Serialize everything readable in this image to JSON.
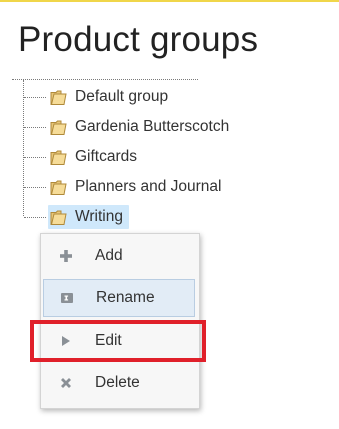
{
  "page": {
    "title": "Product groups"
  },
  "tree": {
    "items": [
      {
        "label": "Default group"
      },
      {
        "label": "Gardenia Butterscotch"
      },
      {
        "label": "Giftcards"
      },
      {
        "label": "Planners and Journal"
      },
      {
        "label": "Writing",
        "selected": true
      }
    ]
  },
  "context_menu": {
    "items": [
      {
        "label": "Add",
        "icon": "plus-icon"
      },
      {
        "label": "Rename",
        "icon": "rename-icon",
        "hovered": true
      },
      {
        "label": "Edit",
        "icon": "edit-arrow-icon",
        "highlighted": true
      },
      {
        "label": "Delete",
        "icon": "delete-icon"
      }
    ]
  },
  "colors": {
    "accent_top_line": "#f0d64a",
    "selected_background": "#cfe8fb",
    "menu_hover_background": "#e2ecf6",
    "highlight_border": "#e0202a"
  }
}
